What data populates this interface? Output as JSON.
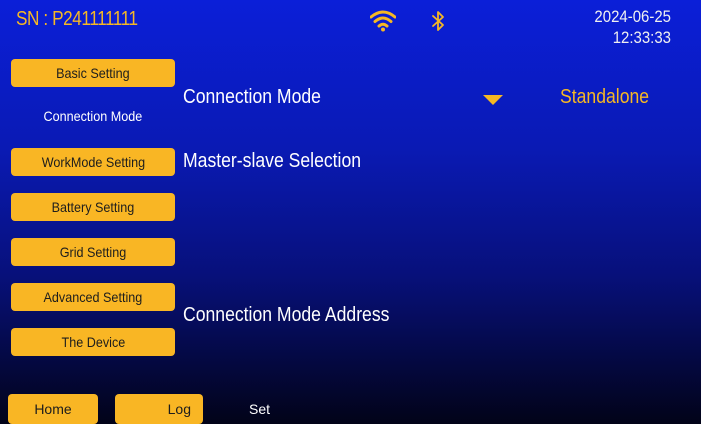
{
  "header": {
    "serial": "SN : P241111111",
    "date": "2024-06-25",
    "time": "12:33:33",
    "wifi_icon": "wifi-icon",
    "bluetooth_icon": "bluetooth-icon"
  },
  "sidebar": {
    "items": [
      {
        "label": "Basic Setting",
        "active": false
      },
      {
        "label": "Connection Mode",
        "active": true
      },
      {
        "label": "WorkMode Setting",
        "active": false
      },
      {
        "label": "Battery Setting",
        "active": false
      },
      {
        "label": "Grid Setting",
        "active": false
      },
      {
        "label": "Advanced Setting",
        "active": false
      },
      {
        "label": "The Device",
        "active": false
      }
    ]
  },
  "main": {
    "connection_mode_label": "Connection Mode",
    "connection_mode_value": "Standalone",
    "master_slave_label": "Master-slave Selection",
    "address_label": "Connection Mode Address"
  },
  "bottom_nav": {
    "home": "Home",
    "log": "Log",
    "set": "Set"
  },
  "colors": {
    "accent": "#f9b624",
    "background_top": "#0b1fd8",
    "background_bottom": "#020318",
    "text": "#ffffff"
  }
}
